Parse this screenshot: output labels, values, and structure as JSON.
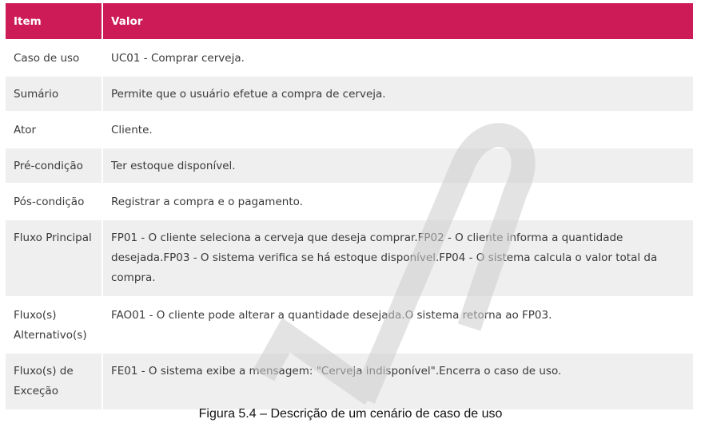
{
  "header": {
    "item_label": "Item",
    "valor_label": "Valor",
    "color": "#cc1b56"
  },
  "rows": [
    {
      "item": "Caso de uso",
      "valor": "UC01 - Comprar cerveja."
    },
    {
      "item": "Sumário",
      "valor": "Permite que o usuário efetue a compra de cerveja."
    },
    {
      "item": "Ator",
      "valor": "Cliente."
    },
    {
      "item": "Pré-condição",
      "valor": "Ter estoque disponível."
    },
    {
      "item": "Pós-condição",
      "valor": "Registrar a compra e o pagamento."
    },
    {
      "item": "Fluxo Principal",
      "valor": "FP01 - O cliente seleciona a cerveja que deseja comprar.FP02 - O cliente informa a quantidade desejada.FP03 - O sistema verifica se há estoque disponível.FP04 - O sistema calcula o valor total da compra."
    },
    {
      "item": "Fluxo(s) Alternativo(s)",
      "valor": "FAO01 - O cliente pode alterar a quantidade desejada.O sistema retorna ao FP03."
    },
    {
      "item": "Fluxo(s) de Exceção",
      "valor": "FE01 - O sistema exibe a mensagem: \"Cerveja indisponível\".Encerra o caso de uso."
    }
  ],
  "caption": "Figura 5.4 – Descrição de um cenário de caso de uso",
  "watermark": {
    "icon": "logo-watermark",
    "color": "#cccccc"
  }
}
